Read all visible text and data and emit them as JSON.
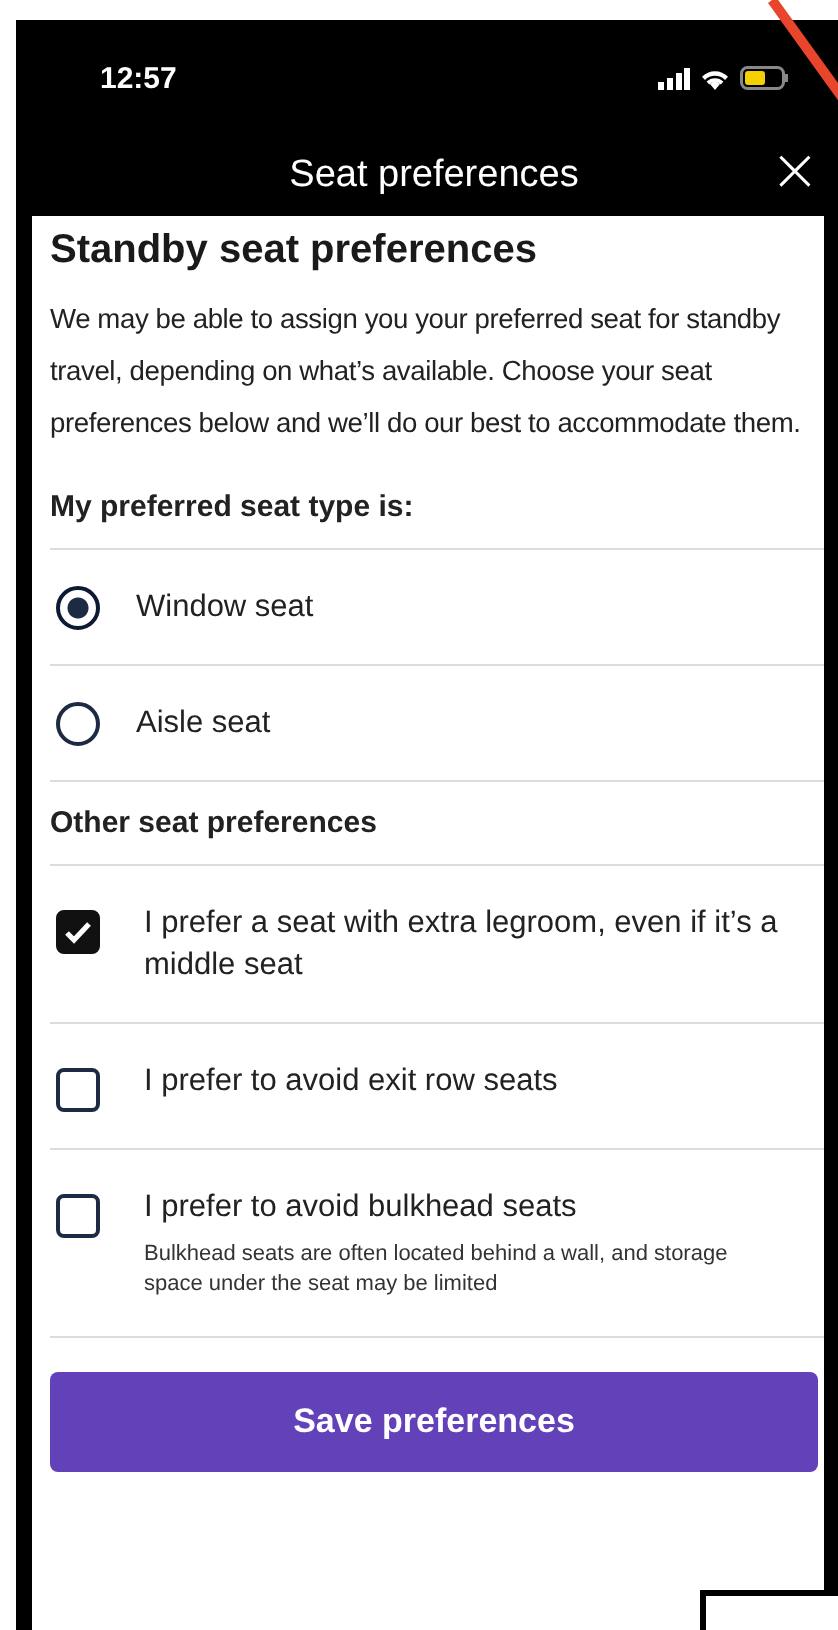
{
  "status_bar": {
    "time": "12:57"
  },
  "header": {
    "title": "Seat preferences",
    "close": "×"
  },
  "heading": "Standby seat preferences",
  "intro": "We may be able to assign you your preferred seat for standby travel, depending on what’s available. Choose your seat preferences below and we’ll do our best to accommodate them.",
  "seat_type": {
    "label": "My preferred seat type is:",
    "options": [
      {
        "label": "Window seat",
        "selected": true
      },
      {
        "label": "Aisle seat",
        "selected": false
      }
    ]
  },
  "other": {
    "label": "Other seat preferences",
    "options": [
      {
        "label": "I prefer a seat with extra legroom, even if it’s a middle seat",
        "checked": true
      },
      {
        "label": "I prefer to avoid exit row seats",
        "checked": false
      },
      {
        "label": "I prefer to avoid bulkhead seats",
        "checked": false,
        "note": "Bulkhead seats are often located behind a wall, and storage space under the seat may be limited"
      }
    ]
  },
  "save_button": "Save preferences"
}
